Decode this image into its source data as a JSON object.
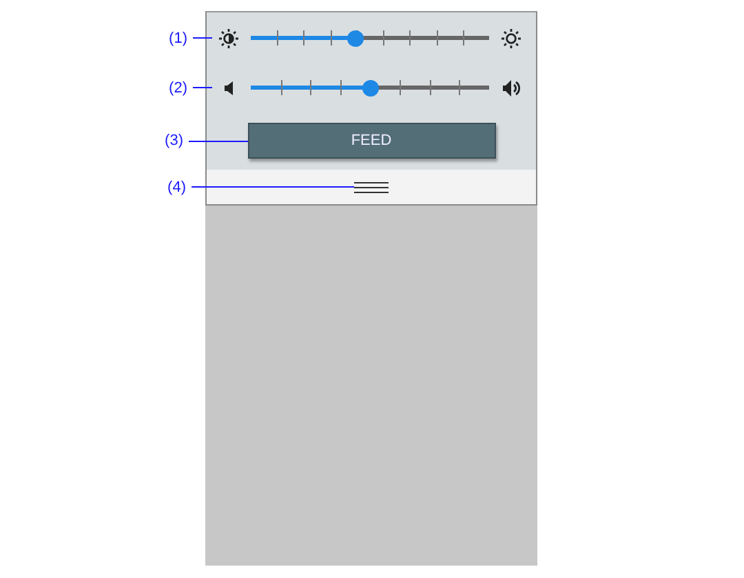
{
  "sliders": [
    {
      "kind": "brightness",
      "level": 0.44,
      "callout": "(1)"
    },
    {
      "kind": "volume",
      "level": 0.5,
      "callout": "(2)"
    }
  ],
  "feed_button": {
    "label": "FEED",
    "callout": "(3)"
  },
  "menu_handle": {
    "callout": "(4)"
  }
}
